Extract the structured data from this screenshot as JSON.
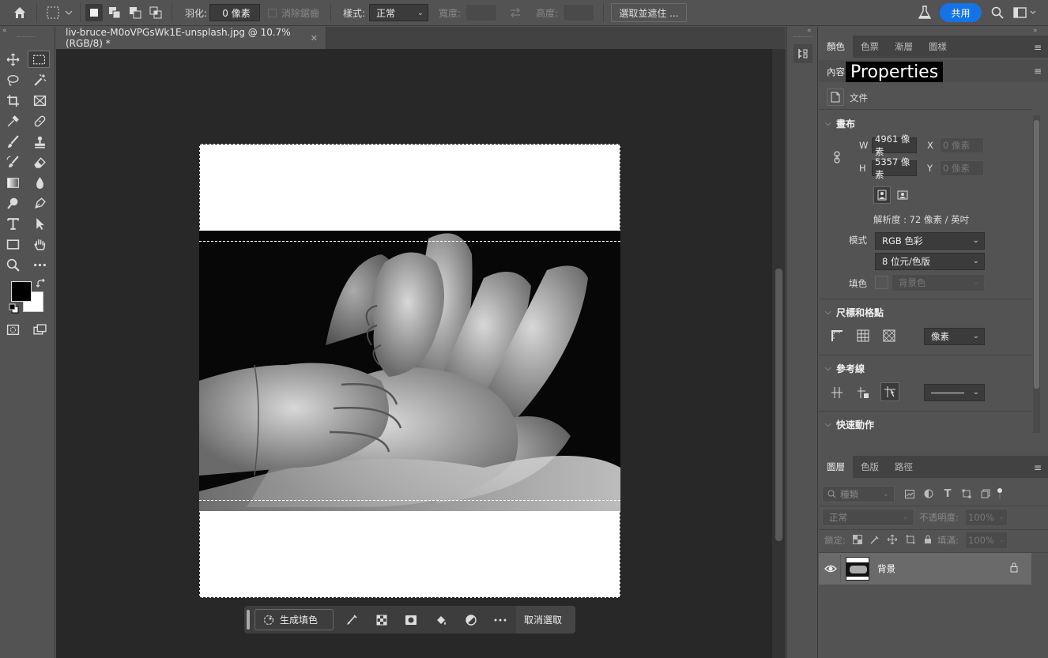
{
  "options_bar": {
    "feather_label": "羽化:",
    "feather_value": "0 像素",
    "antialias_label": "消除鋸齒",
    "style_label": "樣式:",
    "style_value": "正常",
    "width_label": "寬度:",
    "height_label": "高度:",
    "select_mask_label": "選取並遮住 ...",
    "share_label": "共用"
  },
  "document": {
    "tab_title": "liv-bruce-M0oVPGsWk1E-unsplash.jpg @ 10.7% (RGB/8) *"
  },
  "context_bar": {
    "generative_fill_label": "生成填色",
    "deselect_label": "取消選取"
  },
  "top_panel": {
    "tabs": [
      "顏色",
      "色票",
      "漸層",
      "圖樣"
    ]
  },
  "properties": {
    "tab_short": "內容",
    "tooltip": "Properties",
    "doc_type_label": "文件",
    "canvas_header": "畫布",
    "w_label": "W",
    "w_value": "4961 像素",
    "h_label": "H",
    "h_value": "5357 像素",
    "x_label": "X",
    "x_value": "0 像素",
    "y_label": "Y",
    "y_value": "0 像素",
    "resolution": "解析度 : 72 像素 / 英吋",
    "mode_label": "模式",
    "mode_value": "RGB 色彩",
    "depth_value": "8 位元/色版",
    "fill_label": "填色",
    "fill_value": "背景色",
    "rulers_header": "尺標和格點",
    "rulers_unit": "像素",
    "guides_header": "參考線",
    "quick_actions_header": "快速動作"
  },
  "layers_panel": {
    "tabs": [
      "圖層",
      "色版",
      "路徑"
    ],
    "filter_label": "種類",
    "blend_mode": "正常",
    "opacity_label": "不透明度:",
    "opacity_value": "100%",
    "lock_label": "鎖定:",
    "fill_label": "填滿:",
    "fill_value": "100%",
    "layers": [
      {
        "name": "背景",
        "visible": true,
        "locked": true
      }
    ]
  },
  "colors": {
    "accent": "#1473e6",
    "foreground": "#000000",
    "background": "#ffffff"
  }
}
